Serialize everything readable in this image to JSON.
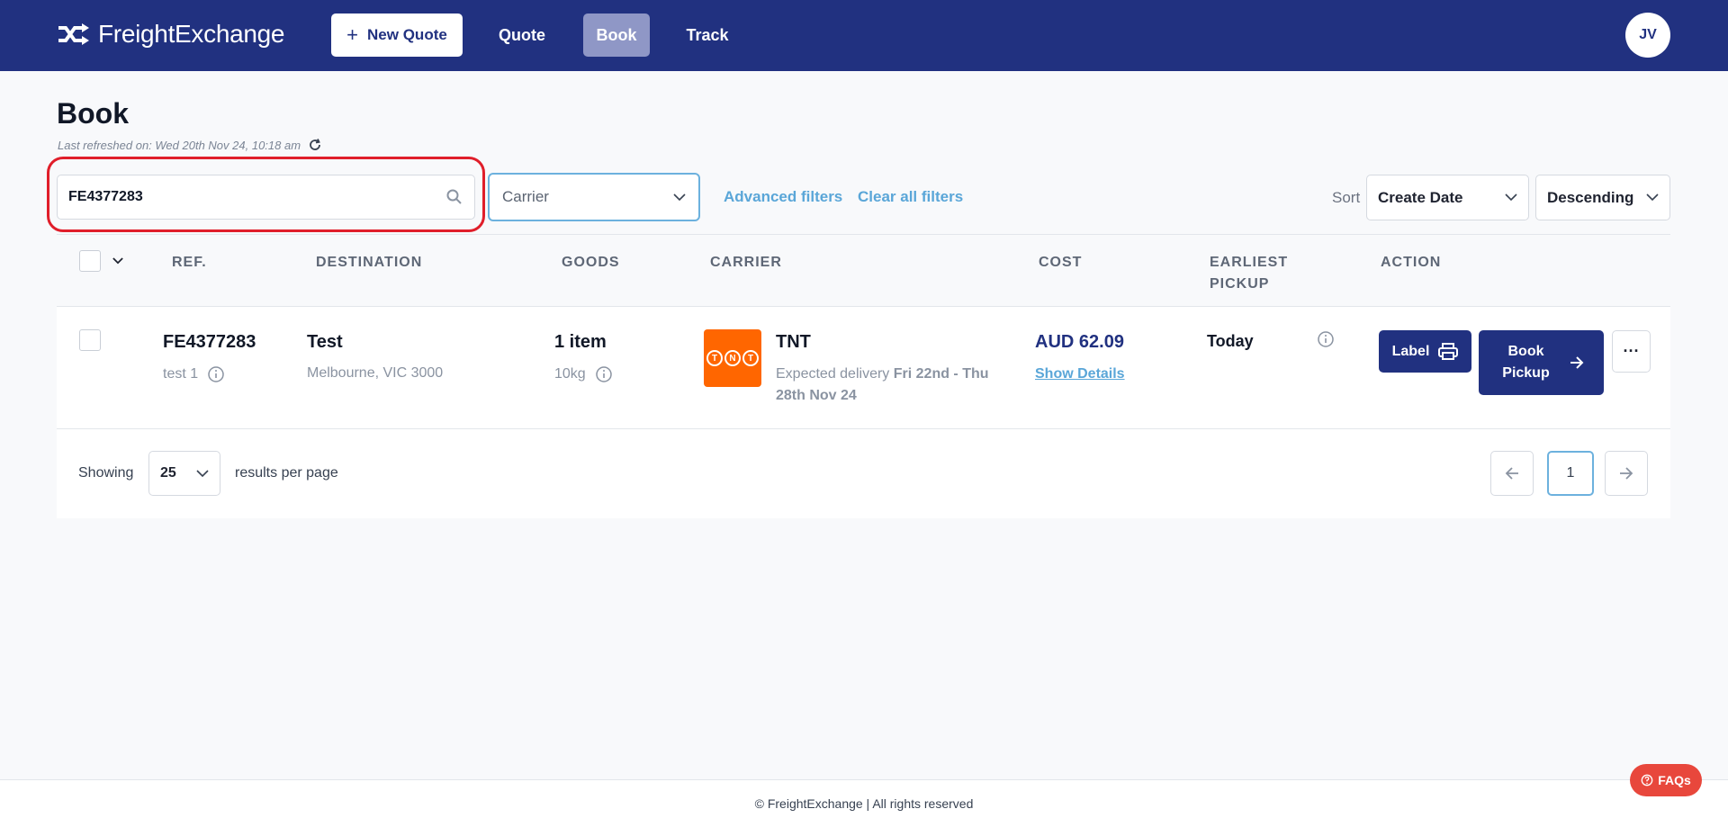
{
  "header": {
    "brand": "FreightExchange",
    "new_quote_label": "New Quote",
    "nav": [
      "Quote",
      "Book",
      "Track"
    ],
    "active_nav": "Book",
    "avatar_initials": "JV",
    "brand_color": "#213180"
  },
  "page": {
    "title": "Book",
    "last_refreshed": "Last refreshed on: Wed 20th Nov 24, 10:18 am"
  },
  "filters": {
    "search_value": "FE4377283",
    "carrier_placeholder": "Carrier",
    "advanced_filters": "Advanced filters",
    "clear_all_filters": "Clear all filters",
    "sort_label": "Sort",
    "sort_field": "Create Date",
    "sort_order": "Descending"
  },
  "table": {
    "headers": {
      "ref": "REF.",
      "destination": "DESTINATION",
      "goods": "GOODS",
      "carrier": "CARRIER",
      "cost": "COST",
      "earliest_pickup_1": "EARLIEST",
      "earliest_pickup_2": "PICKUP",
      "action": "ACTION"
    },
    "rows": [
      {
        "ref": "FE4377283",
        "ref_sub": "test 1",
        "destination": "Test",
        "destination_sub": "Melbourne, VIC 3000",
        "goods": "1 item",
        "goods_sub": "10kg",
        "carrier": "TNT",
        "carrier_logo_text": "TNT",
        "expected_prefix": "Expected delivery",
        "expected_dates": "Fri 22nd - Thu 28th Nov 24",
        "cost": "AUD 62.09",
        "show_details": "Show Details",
        "earliest_pickup": "Today",
        "label_button": "Label",
        "book_pickup_button": "Book Pickup",
        "more_button": "···"
      }
    ]
  },
  "pagination": {
    "showing": "Showing",
    "per_page_value": "25",
    "per_page_text": "results per page",
    "current_page": "1"
  },
  "footer": {
    "copyright": "© FreightExchange | All rights reserved",
    "faq_label": "FAQs"
  }
}
